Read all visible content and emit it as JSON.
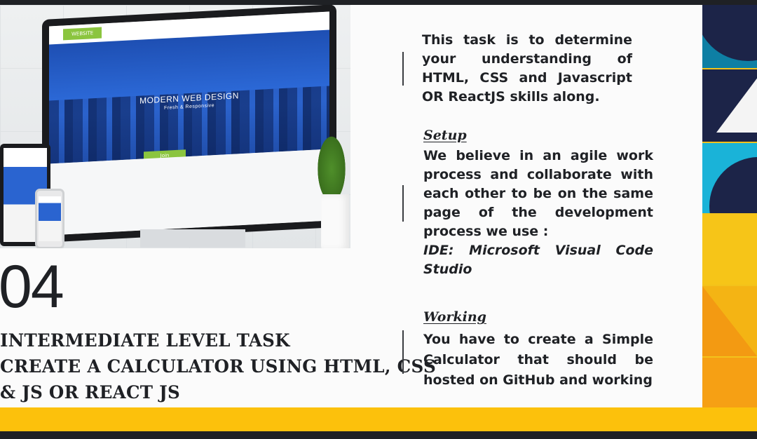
{
  "task_number": "04",
  "heading": {
    "line1": "INTERMEDIATE LEVEL TASK",
    "line2": "CREATE A CALCULATOR USING HTML, CSS",
    "line3": "& JS OR REACT JS"
  },
  "intro": "This task is to determine your understanding  of HTML, CSS and Javascript OR ReactJS skills along.",
  "setup": {
    "title": "Setup ",
    "body": "We believe in an agile work process and collaborate with each other to be on the same page of the development process we use :",
    "ide": "IDE: Microsoft Visual Code Studio"
  },
  "working": {
    "title": "Working ",
    "body": "You have to create a Simple Calculator that should be hosted on GitHub and working"
  },
  "mockup": {
    "nav_label": "WEBSITE",
    "hero_title": "MODERN WEB DESIGN",
    "hero_subtitle": "Fresh & Responsive",
    "button_label": "Join"
  },
  "colors": {
    "accent_yellow": "#fcc10c",
    "dark": "#1f2125",
    "background": "#fbfbfb"
  }
}
